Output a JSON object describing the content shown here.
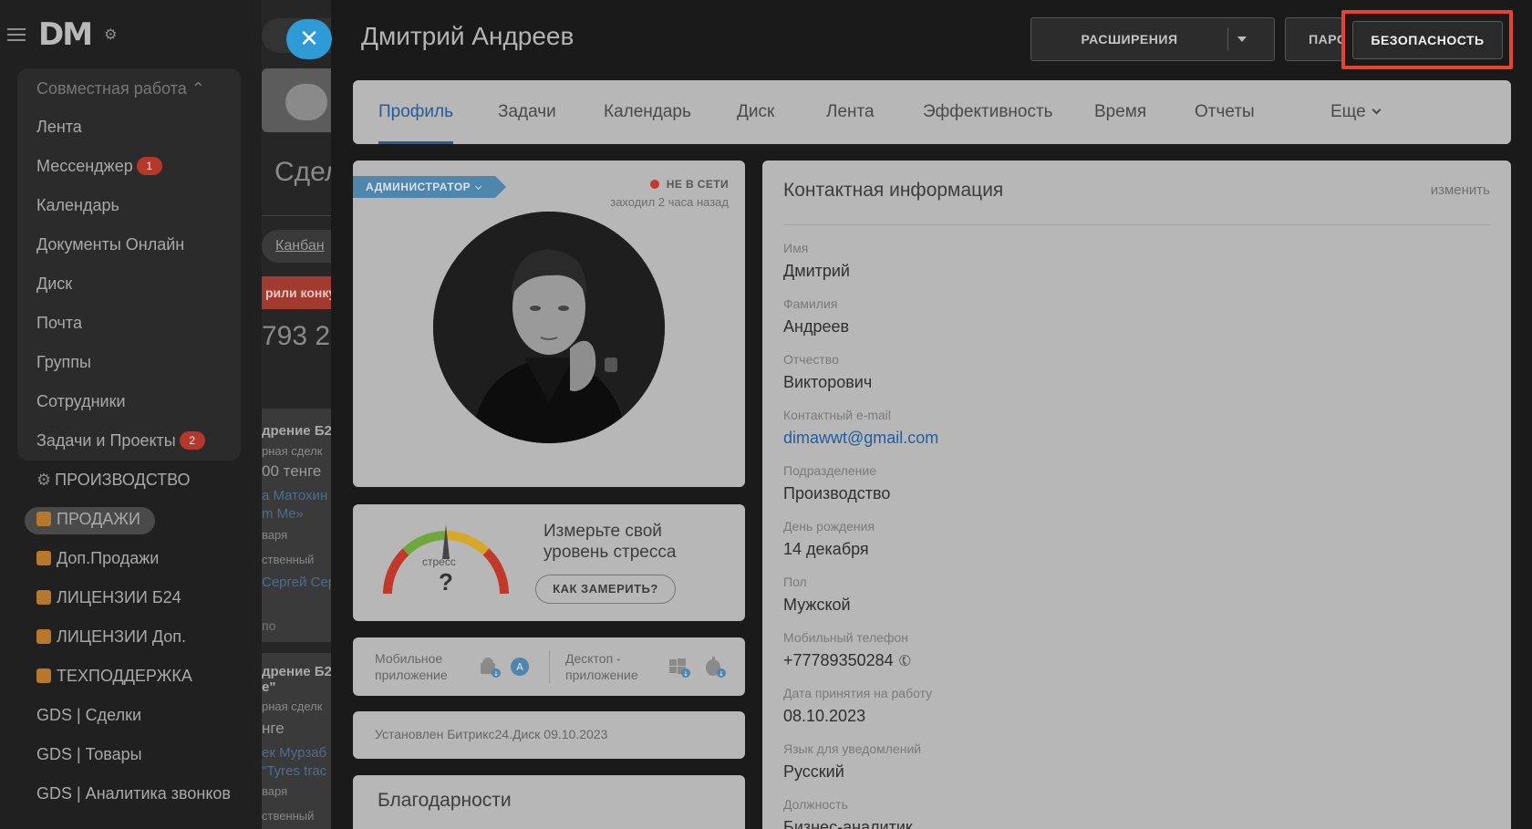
{
  "sidebar": {
    "logo_text": "DM",
    "group_header": "Совместная работа",
    "items": [
      {
        "label": "Лента"
      },
      {
        "label": "Мессенджер",
        "badge": "1"
      },
      {
        "label": "Календарь"
      },
      {
        "label": "Документы Онлайн"
      },
      {
        "label": "Диск"
      },
      {
        "label": "Почта"
      },
      {
        "label": "Группы"
      },
      {
        "label": "Сотрудники"
      },
      {
        "label": "Задачи и Проекты",
        "badge": "2"
      }
    ],
    "sections": [
      {
        "label": "ПРОИЗВОДСТВО"
      },
      {
        "label": "ПРОДАЖИ"
      },
      {
        "label": "Доп.Продажи"
      },
      {
        "label": "ЛИЦЕНЗИИ Б24"
      },
      {
        "label": "ЛИЦЕНЗИИ Доп."
      },
      {
        "label": "ТЕХПОДДЕРЖКА"
      },
      {
        "label": "GDS | Сделки"
      },
      {
        "label": "GDS | Товары"
      },
      {
        "label": "GDS | Аналитика звонков"
      }
    ]
  },
  "background": {
    "page_title_fragment": "Сдел",
    "view_fragment": "Канбан",
    "red_strip_fragment": "рили конку",
    "sum_fragment": "793 2",
    "deal1": [
      "дрение Б2",
      "рная сделк",
      "00 тенге",
      "а Матохин",
      "m Me»",
      "варя",
      "ственный",
      "Сергей Сер",
      "по"
    ],
    "deal2": [
      "дрение Б2",
      "е\"",
      "рная сделк",
      "нге",
      "ек Мурзаб",
      "\"Tyres trac",
      "варя",
      "ственный"
    ]
  },
  "header": {
    "user_name": "Дмитрий Андреев",
    "extensions_label": "РАСШИРЕНИЯ",
    "passwords_label": "ПАРОЛИ",
    "security_label": "БЕЗОПАСНОСТЬ",
    "highlight_color": "#e8432f"
  },
  "tabs": [
    {
      "label": "Профиль",
      "active": true
    },
    {
      "label": "Задачи"
    },
    {
      "label": "Календарь"
    },
    {
      "label": "Диск"
    },
    {
      "label": "Лента"
    },
    {
      "label": "Эффективность"
    },
    {
      "label": "Время"
    },
    {
      "label": "Отчеты"
    },
    {
      "label": "Еще"
    }
  ],
  "profile": {
    "role": "АДМИНИСТРАТОР",
    "status": "НЕ В СЕТИ",
    "last_seen": "заходил 2 часа назад"
  },
  "stress": {
    "gauge_label": "стресс",
    "gauge_value": "?",
    "prompt": "Измерьте свой уровень стресса",
    "button": "КАК ЗАМЕРИТЬ?"
  },
  "apps": {
    "mobile_label": "Мобильное приложение",
    "desktop_label": "Десктоп - приложение"
  },
  "disk_status": "Установлен Битрикс24.Диск 09.10.2023",
  "thanks_title": "Благодарности",
  "contact": {
    "title": "Контактная информация",
    "edit_label": "изменить",
    "fields": [
      {
        "label": "Имя",
        "value": "Дмитрий"
      },
      {
        "label": "Фамилия",
        "value": "Андреев"
      },
      {
        "label": "Отчество",
        "value": "Викторович"
      },
      {
        "label": "Контактный e-mail",
        "value": "dimawwt@gmail.com"
      },
      {
        "label": "Подразделение",
        "value": "Производство"
      },
      {
        "label": "День рождения",
        "value": "14 декабря"
      },
      {
        "label": "Пол",
        "value": "Мужской"
      },
      {
        "label": "Мобильный телефон",
        "value": "+77789350284"
      },
      {
        "label": "Дата принятия на работу",
        "value": "08.10.2023"
      },
      {
        "label": "Язык для уведомлений",
        "value": "Русский"
      },
      {
        "label": "Должность",
        "value": "Бизнес-аналитик"
      }
    ]
  }
}
